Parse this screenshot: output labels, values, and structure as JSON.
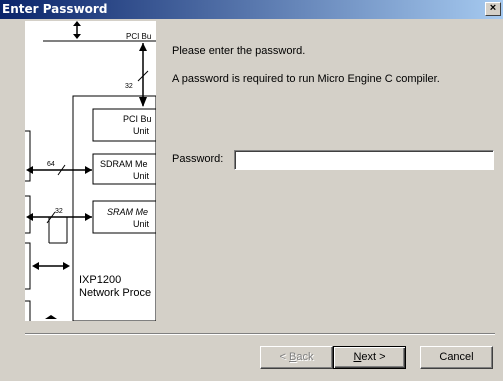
{
  "window": {
    "title": "Enter Password",
    "close_glyph": "×"
  },
  "diagram": {
    "pci_bus_label": "PCI Bu",
    "pci_width": "32",
    "pci_unit": [
      "PCI Bu",
      "Unit"
    ],
    "sdram_width": "64",
    "sdram_unit": [
      "SDRAM Me",
      "Unit"
    ],
    "sram_width": "32",
    "sram_unit": [
      "SRAM Me",
      "Unit"
    ],
    "chip_name": [
      "IXP1200",
      "Network Proce"
    ]
  },
  "content": {
    "prompt_line1": "Please enter the password.",
    "prompt_line2": "A password is required to run Micro Engine C compiler.",
    "password_label": "Password:",
    "password_value": ""
  },
  "buttons": {
    "back": {
      "pre": "< ",
      "u": "B",
      "post": "ack"
    },
    "next": {
      "pre": "",
      "u": "N",
      "post": "ext >"
    },
    "cancel": "Cancel"
  }
}
